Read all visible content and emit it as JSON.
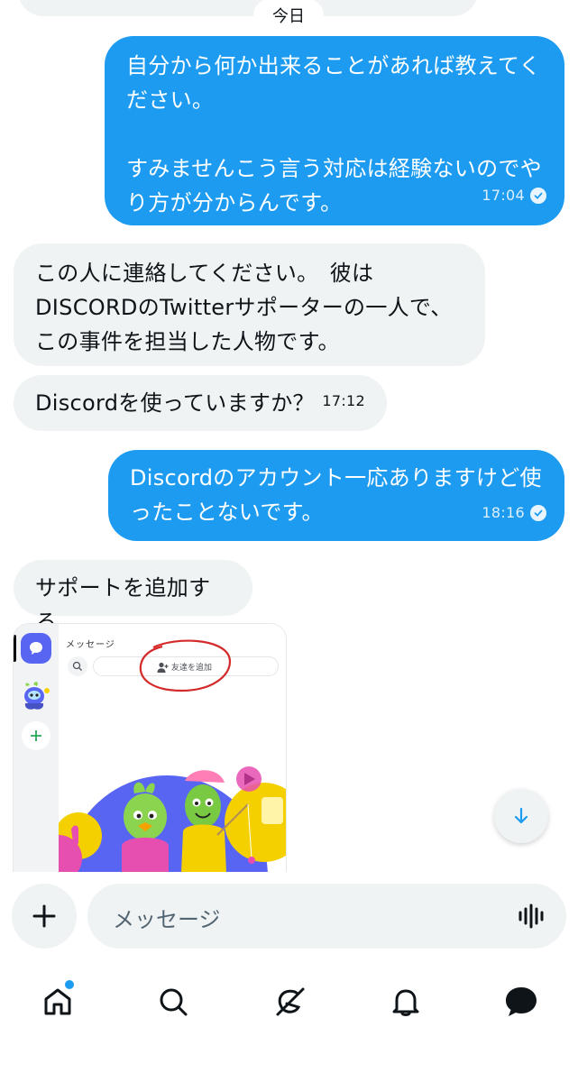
{
  "date_label": "今日",
  "messages": [
    {
      "from": "me",
      "text": "自分から何か出来ることがあれば教えてく\nださい。\n\nすみませんこう言う対応は経験ないのでや\nり方が分からんです。",
      "time": "17:04"
    },
    {
      "from": "them",
      "text": "この人に連絡してください。　彼は\nDISCORDのTwitterサポーターの一人で、\nこの事件を担当した人物です。"
    },
    {
      "from": "them",
      "text": "Discordを使っていますか？",
      "time": "17:12"
    },
    {
      "from": "me",
      "text": "Discordのアカウント一応ありますけど使\nったことないです。",
      "time": "18:16"
    },
    {
      "from": "them",
      "text": "サポートを追加する"
    }
  ],
  "attachment": {
    "header": "メッセージ",
    "add_friend": "友達を追加"
  },
  "composer": {
    "placeholder": "メッセージ"
  },
  "tabs": [
    "home",
    "search",
    "grok",
    "notifications",
    "messages"
  ],
  "colors": {
    "accent": "#1d9bf0",
    "bubble_incoming": "#eff3f4",
    "annotation_circle": "#d42a2a"
  }
}
